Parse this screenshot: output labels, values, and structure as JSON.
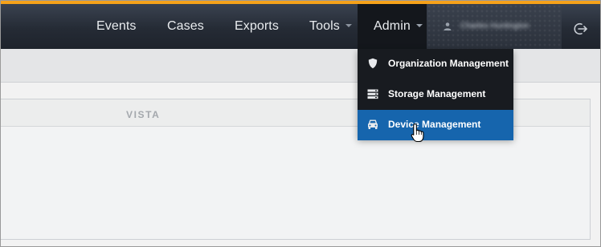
{
  "nav": {
    "items": [
      {
        "label": "Events"
      },
      {
        "label": "Cases"
      },
      {
        "label": "Exports"
      },
      {
        "label": "Tools"
      },
      {
        "label": "Admin"
      }
    ],
    "user_name": "Charles Huntington",
    "user_icon": "user-icon",
    "logout_icon": "logout-icon"
  },
  "panel": {
    "logo_text": "VISTA"
  },
  "admin_menu": {
    "items": [
      {
        "label": "Organization Management",
        "icon": "shield-icon",
        "active": false
      },
      {
        "label": "Storage Management",
        "icon": "storage-icon",
        "active": false
      },
      {
        "label": "Device Management",
        "icon": "car-icon",
        "active": true
      }
    ]
  },
  "colors": {
    "accent_top": "#f6a21a",
    "nav_bg": "#252b35",
    "menu_bg": "#181b20",
    "active_item": "#1665ad"
  }
}
